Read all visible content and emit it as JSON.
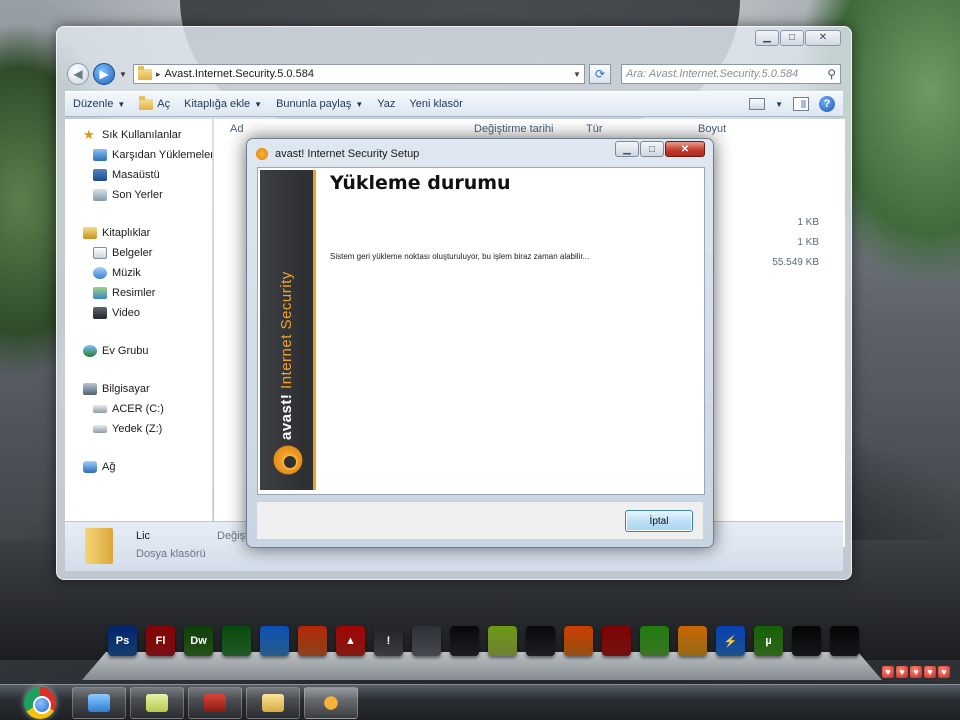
{
  "explorer": {
    "window_title": "",
    "address": {
      "path": "Avast.Internet.Security.5.0.584"
    },
    "search": {
      "placeholder": "Ara: Avast.Internet.Security.5.0.584"
    },
    "toolbar": {
      "organize": "Düzenle",
      "open": "Aç",
      "add_to_library": "Kitaplığa ekle",
      "share_with": "Bununla paylaş",
      "burn": "Yaz",
      "new_folder": "Yeni klasör"
    },
    "nav": {
      "favorites": {
        "label": "Sık Kullanılanlar",
        "items": [
          "Karşıdan Yüklemeler",
          "Masaüstü",
          "Son Yerler"
        ]
      },
      "libraries": {
        "label": "Kitaplıklar",
        "items": [
          "Belgeler",
          "Müzik",
          "Resimler",
          "Video"
        ]
      },
      "homegroup": "Ev Grubu",
      "computer": {
        "label": "Bilgisayar",
        "items": [
          "ACER (C:)",
          "Yedek (Z:)"
        ]
      },
      "network": "Ağ"
    },
    "columns": {
      "name": "Ad",
      "date_modified": "Değiştirme tarihi",
      "type": "Tür",
      "size": "Boyut"
    },
    "files": [
      {
        "icon": "folder",
        "size": ""
      },
      {
        "icon": "folder",
        "size": ""
      },
      {
        "icon": "config",
        "size": "1 KB"
      },
      {
        "icon": "text",
        "size": "1 KB"
      },
      {
        "icon": "installer",
        "size": "55.549 KB"
      }
    ],
    "details": {
      "name": "Lic",
      "type": "Dosya klasörü",
      "modified_label": "Değiştir"
    }
  },
  "setup": {
    "title": "avast! Internet Security Setup",
    "step_title": "Yükleme durumu",
    "status_message": "Sistem geri yükleme noktası oluşturuluyor, bu işlem biraz zaman alabilir...",
    "banner": {
      "brand": "avast!",
      "product": "Internet Security"
    },
    "cancel_label": "İptal"
  },
  "dock": {
    "icons": [
      {
        "name": "photoshop",
        "glyph": "Ps",
        "color": "#1f5fa8"
      },
      {
        "name": "flash",
        "glyph": "Fl",
        "color": "#b8191e"
      },
      {
        "name": "dreamweaver",
        "glyph": "Dw",
        "color": "#3c7d2a"
      },
      {
        "name": "excel",
        "glyph": "",
        "color": "#2f8a3c"
      },
      {
        "name": "picture-viewer",
        "glyph": "",
        "color": "#3a8fd6"
      },
      {
        "name": "powerpoint",
        "glyph": "",
        "color": "#d6652c"
      },
      {
        "name": "upload-arrow",
        "glyph": "▲",
        "color": "#c9281f"
      },
      {
        "name": "warning",
        "glyph": "!",
        "color": "#5a5e63"
      },
      {
        "name": "equalizer",
        "glyph": "",
        "color": "#6b7078"
      },
      {
        "name": "terminal",
        "glyph": "",
        "color": "#2a2e33"
      },
      {
        "name": "notes",
        "glyph": "",
        "color": "#a7c64c"
      },
      {
        "name": "media-center",
        "glyph": "",
        "color": "#2c3036"
      },
      {
        "name": "vlc",
        "glyph": "",
        "color": "#e47c1b"
      },
      {
        "name": "tool",
        "glyph": "",
        "color": "#b31b1b"
      },
      {
        "name": "globe",
        "glyph": "",
        "color": "#5bb33c"
      },
      {
        "name": "shield",
        "glyph": "",
        "color": "#e3a220"
      },
      {
        "name": "lightning",
        "glyph": "⚡",
        "color": "#2c7fd6"
      },
      {
        "name": "utorrent",
        "glyph": "µ",
        "color": "#4b9d2b"
      },
      {
        "name": "cpu-meter",
        "glyph": "",
        "color": "#1f2326"
      },
      {
        "name": "net-meter",
        "glyph": "",
        "color": "#1f2326"
      }
    ]
  },
  "taskbar": {
    "buttons": [
      {
        "name": "control-panel",
        "active": false
      },
      {
        "name": "sticky-notes",
        "active": false
      },
      {
        "name": "media-app",
        "active": false
      },
      {
        "name": "explorer",
        "active": false
      },
      {
        "name": "avast",
        "active": true
      }
    ]
  }
}
